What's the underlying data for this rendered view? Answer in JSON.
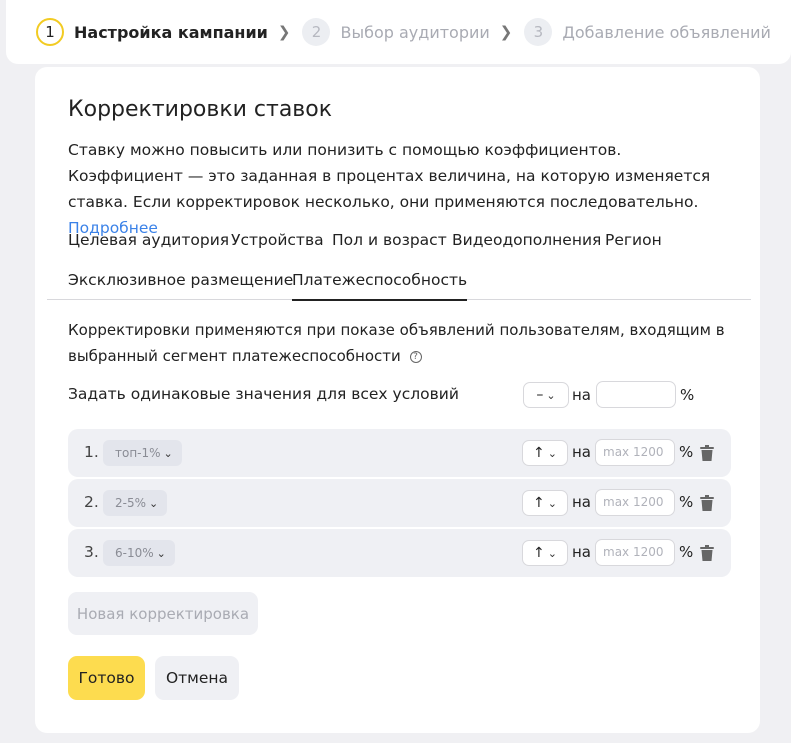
{
  "stepper": {
    "steps": [
      {
        "num": "1",
        "label": "Настройка кампании"
      },
      {
        "num": "2",
        "label": "Выбор аудитории"
      },
      {
        "num": "3",
        "label": "Добавление объявлений"
      }
    ]
  },
  "section": {
    "title": "Корректировки ставок",
    "description": "Ставку можно повысить или понизить с помощью коэффициентов. Коэффициент — это заданная в процентах величина, на которую изменяется ставка. Если корректировок несколько, они применяются последовательно.",
    "more_link": "Подробнее"
  },
  "tabs": [
    "Целевая аудитория",
    "Устройства",
    "Пол и возраст",
    "Видеодополнения",
    "Регион",
    "Эксклюзивное размещение",
    "Платежеспособность"
  ],
  "active_tab": "Платежеспособность",
  "info": {
    "text": "Корректировки применяются при показе объявлений пользователям, входящим в выбранный сегмент платежеспособности"
  },
  "apply_all": {
    "label": "Задать одинаковые значения для всех условий",
    "direction": "–",
    "on_label": "на",
    "value": "",
    "unit": "%"
  },
  "adjustments": [
    {
      "num": "1.",
      "segment": "топ-1%",
      "direction": "↑",
      "on_label": "на",
      "placeholder": "max 1200",
      "unit": "%"
    },
    {
      "num": "2.",
      "segment": "2-5%",
      "direction": "↑",
      "on_label": "на",
      "placeholder": "max 1200",
      "unit": "%"
    },
    {
      "num": "3.",
      "segment": "6-10%",
      "direction": "↑",
      "on_label": "на",
      "placeholder": "max 1200",
      "unit": "%"
    }
  ],
  "buttons": {
    "new_adjustment": "Новая корректировка",
    "done": "Готово",
    "cancel": "Отмена"
  },
  "colors": {
    "accent_yellow": "#fddc4f",
    "link_blue": "#3b82e8",
    "row_bg": "#eff0f4"
  }
}
